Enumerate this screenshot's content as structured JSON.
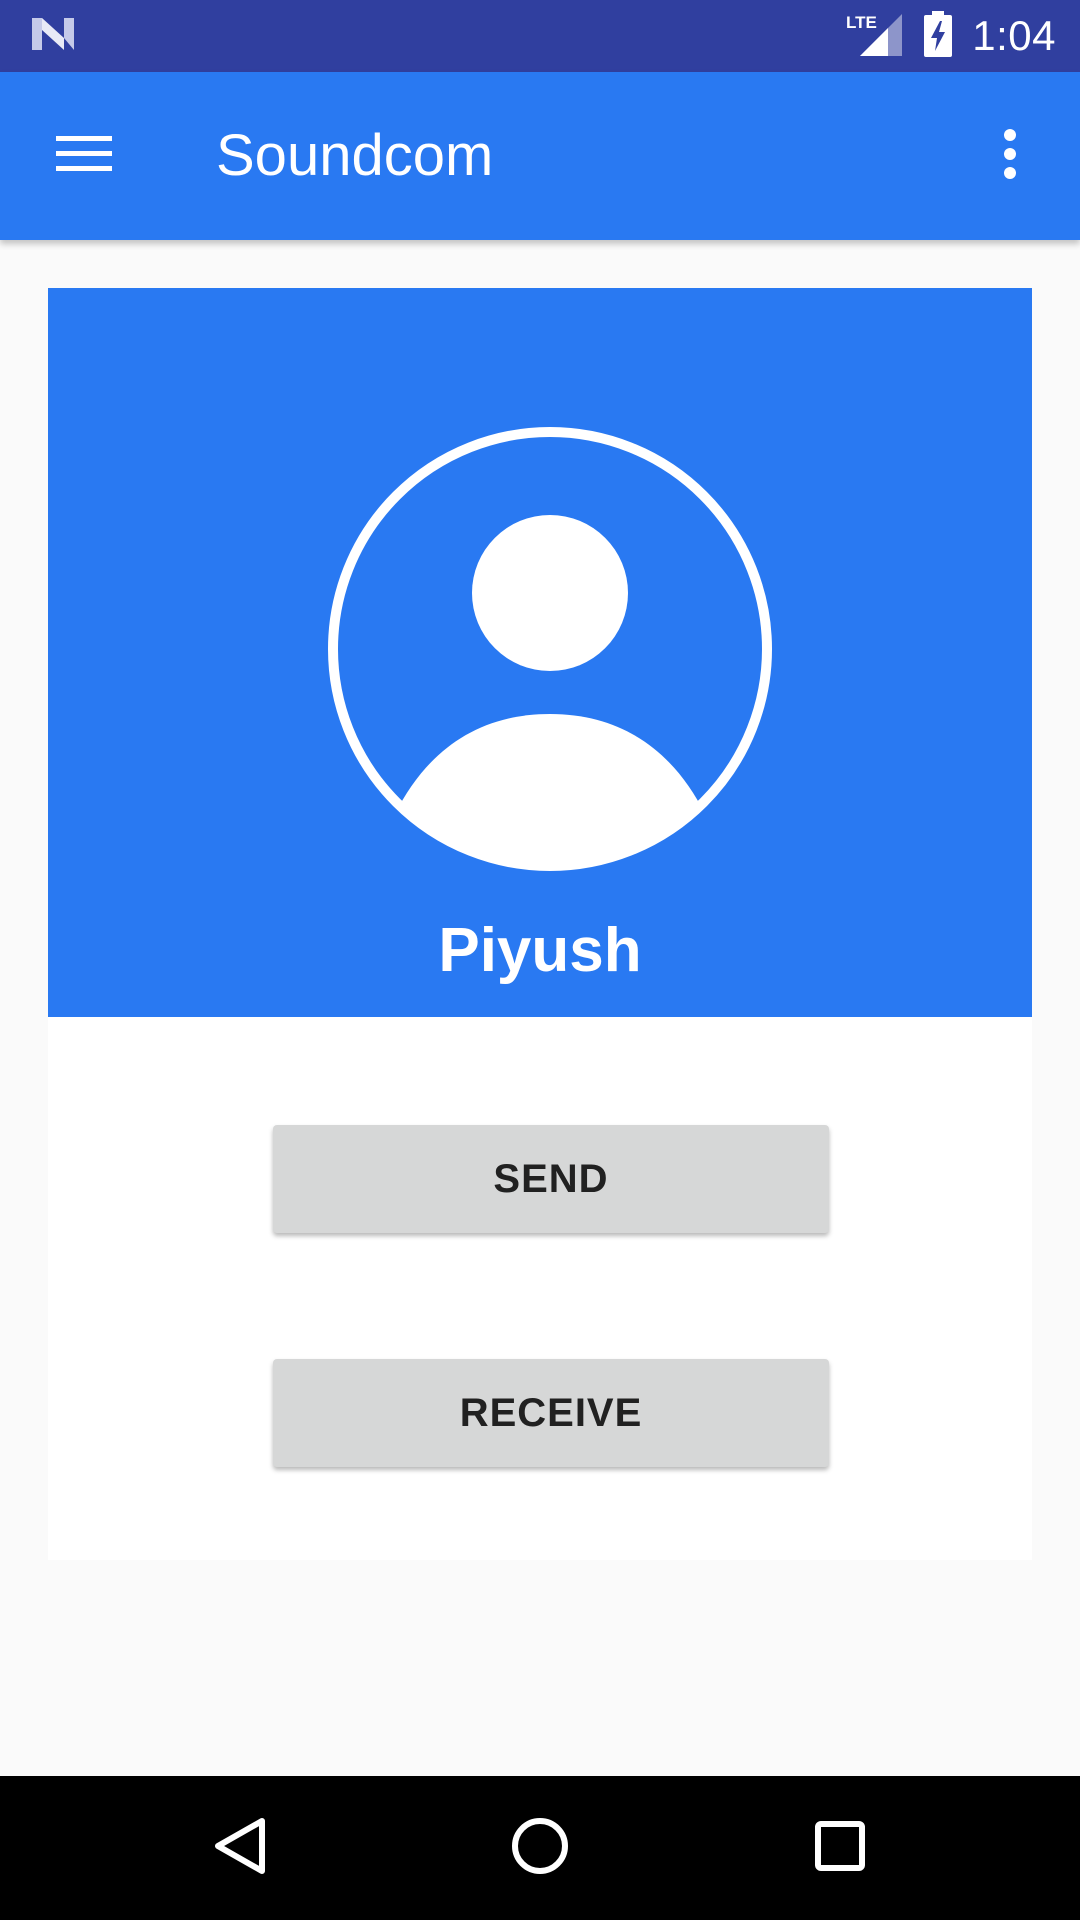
{
  "status_bar": {
    "network_label": "LTE",
    "time": "1:04",
    "icons": [
      "notification-n-icon",
      "lte-signal-icon",
      "battery-charging-icon"
    ]
  },
  "app_bar": {
    "title": "Soundcom",
    "icons": [
      "menu-icon",
      "more-vert-icon"
    ]
  },
  "profile": {
    "name": "Piyush",
    "icon": "account-circle-icon"
  },
  "actions": {
    "send_label": "SEND",
    "receive_label": "RECEIVE"
  },
  "nav_bar": {
    "icons": [
      "back-icon",
      "home-icon",
      "recents-icon"
    ]
  },
  "colors": {
    "status_bar": "#303f9f",
    "primary": "#2979f2",
    "button": "#d6d7d7",
    "background": "#fafafa"
  }
}
